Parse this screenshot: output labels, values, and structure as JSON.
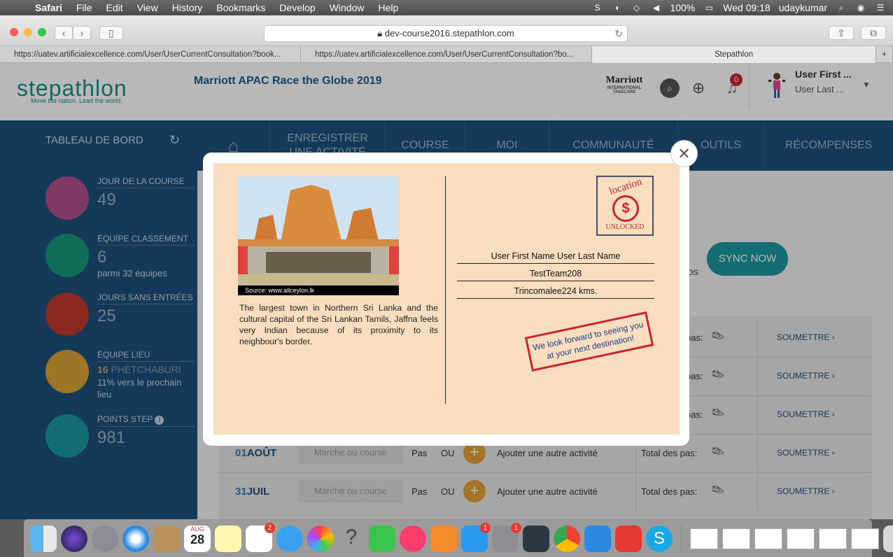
{
  "menubar": {
    "app": "Safari",
    "items": [
      "File",
      "Edit",
      "View",
      "History",
      "Bookmarks",
      "Develop",
      "Window",
      "Help"
    ],
    "battery": "100%",
    "clock": "Wed 09:18",
    "user": "udaykumar"
  },
  "browser": {
    "url": "dev-course2016.stepathlon.com",
    "tabs": [
      "https://uatev.artificialexcellence.com/User/UserCurrentConsultation?book...",
      "https://uatev.artificialexcellence.com/User/UserCurrentConsultation?bo...",
      "Stepathlon"
    ]
  },
  "header": {
    "logo": "stepathlon",
    "logo_tagline": "Move the nation. Lead the world.",
    "event_title": "Marriott APAC Race the Globe 2019",
    "sponsor": "Marriott",
    "sponsor_sub": "INTERNATIONAL",
    "sponsor_sub2": "TAKECARE",
    "notification_count": "0",
    "user_first": "User First ...",
    "user_last": "User Last ..."
  },
  "sidebar": {
    "title": "TABLEAU DE BORD",
    "stats": [
      {
        "label": "JOUR DE LA COURSE",
        "value": "49",
        "sub": "",
        "color": "#b04f8c",
        "icon": "race-flag-icon"
      },
      {
        "label": "ÉQUIPE CLASSEMENT",
        "value": "6",
        "sub": "parmi 32 équipes",
        "color": "#169977",
        "icon": "medal-icon"
      },
      {
        "label": "JOURS SANS ENTRÉES",
        "value": "25",
        "sub": "",
        "color": "#c0392b",
        "icon": "calendar-icon"
      },
      {
        "label": "ÉQUIPE LIEU",
        "value": "16",
        "value_suffix": "PHETCHABURI",
        "sub": "11% vers le prochain lieu",
        "color": "#d9a237",
        "icon": "location-icon"
      },
      {
        "label": "POINTS STEP",
        "value": "981",
        "sub": "",
        "color": "#1b97a0",
        "icon": "coin-icon"
      }
    ]
  },
  "nav": {
    "items": [
      "ENREGISTRER UNE ACTIVITÉ",
      "COURSE",
      "MOI",
      "COMMUNAUTÉ",
      "OUTILS",
      "RÉCOMPENSES"
    ]
  },
  "content": {
    "sync_label": "SYNC NOW",
    "sync_aux": "OS",
    "rows": [
      {
        "day": "",
        "month": "",
        "total_label": "pas:",
        "submit": "SOUMETTRE"
      },
      {
        "day": "",
        "month": "",
        "total_label": "pas:",
        "submit": "SOUMETTRE"
      },
      {
        "day": "",
        "month": "",
        "total_label": "pas:",
        "submit": "SOUMETTRE"
      },
      {
        "day": "01",
        "month": "AOÛT",
        "input_placeholder": "Marche ou course",
        "pas": "Pas",
        "ou": "OU",
        "add": "Ajouter une autre activité",
        "total_label": "Total des pas:",
        "submit": "SOUMETTRE"
      },
      {
        "day": "31",
        "month": "JUIL",
        "input_placeholder": "Marche ou course",
        "pas": "Pas",
        "ou": "OU",
        "add": "Ajouter une autre activité",
        "total_label": "Total des pas:",
        "submit": "SOUMETTRE"
      }
    ]
  },
  "postcard": {
    "photo_source": "Source: www.allceylon.lk",
    "description": "The largest town in Northern Sri Lanka and the cultural capital of the Sri Lankan Tamils, Jaffna feels very Indian because of its proximity to its neighbour's border.",
    "stamp_top": "location",
    "stamp_bottom": "UNLOCKED",
    "name": "User First Name User Last Name",
    "team": "TestTeam208",
    "destination": "Trincomalee224 kms.",
    "red_stamp": "We look forward to seeing you at your next destination!"
  },
  "dock": {
    "calendar_month": "AUG",
    "calendar_day": "28",
    "badges": {
      "reminders": "2",
      "appstore": "1",
      "settings": "1"
    }
  }
}
